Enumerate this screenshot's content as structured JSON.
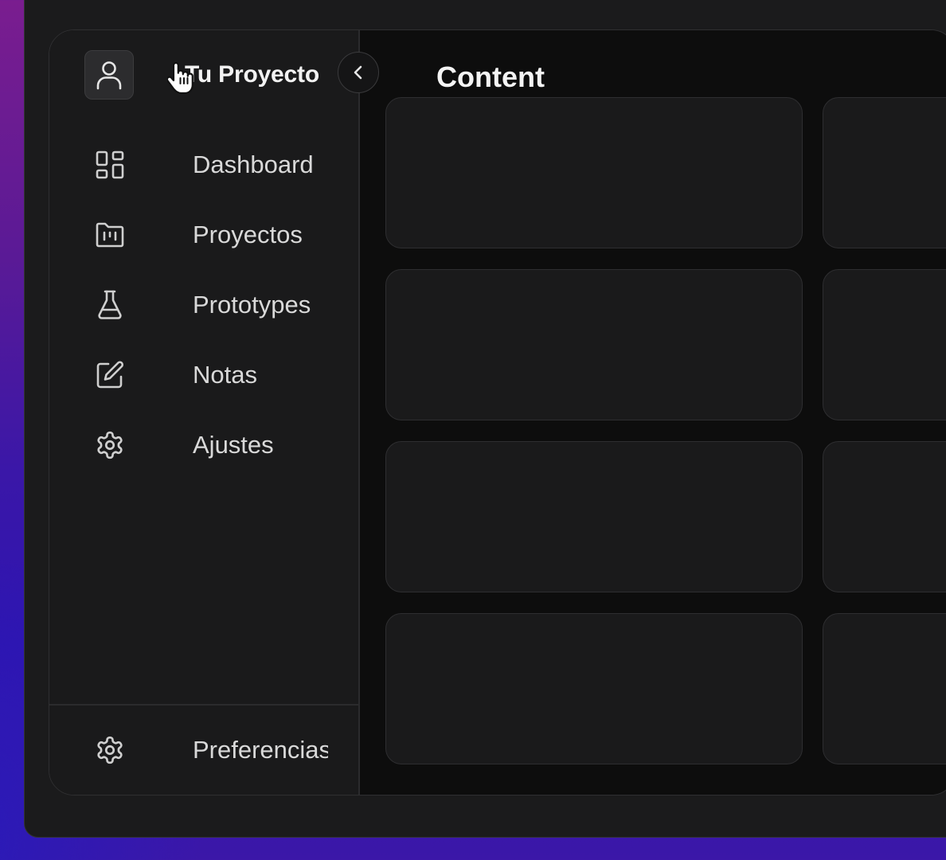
{
  "sidebar": {
    "header": {
      "avatar_icon": "user-icon",
      "project_name": "Tu Proyecto",
      "collapse_icon": "chevron-left-icon"
    },
    "items": [
      {
        "label": "Dashboard",
        "icon": "layout-grid-icon"
      },
      {
        "label": "Proyectos",
        "icon": "folder-kanban-icon"
      },
      {
        "label": "Prototypes",
        "icon": "flask-icon"
      },
      {
        "label": "Notas",
        "icon": "edit-icon"
      },
      {
        "label": "Ajustes",
        "icon": "gear-icon"
      }
    ],
    "footer": {
      "label": "Preferencias",
      "icon": "gear-icon"
    }
  },
  "main": {
    "title": "Content",
    "cards_visible": 8
  },
  "colors": {
    "sidebar_bg": "#1a1a1b",
    "main_bg": "#0d0d0d",
    "card_bg": "#1a1a1b",
    "text_primary": "#f2f2f2",
    "text_secondary": "#d9d9d9",
    "desktop_gradient_top": "#7a1d8f",
    "desktop_gradient_bottom": "#2e14b0"
  }
}
